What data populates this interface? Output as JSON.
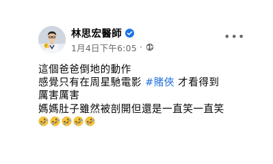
{
  "post": {
    "author_name": "林思宏醫師",
    "timestamp": "1月4日下午6:05",
    "separator": "·",
    "privacy_icon": "globe-icon",
    "verified_icon": "verified-badge-icon",
    "more_icon": "more-options-icon",
    "body": {
      "line1": "這個爸爸倒地的動作",
      "line2_prefix": "感覺只有在周星馳電影 ",
      "line2_hashtag": "#賭俠",
      "line2_suffix": " 才看得到",
      "line3": "厲害厲害",
      "line4": "媽媽肚子雖然被剖開但還是一直笑一直笑"
    },
    "emoji_count": 5,
    "emoji_name": "rolling-on-floor-laughing"
  },
  "colors": {
    "text": "#050505",
    "secondary": "#65676b",
    "hashtag": "#216fdb",
    "verified": "#1b74e4"
  }
}
